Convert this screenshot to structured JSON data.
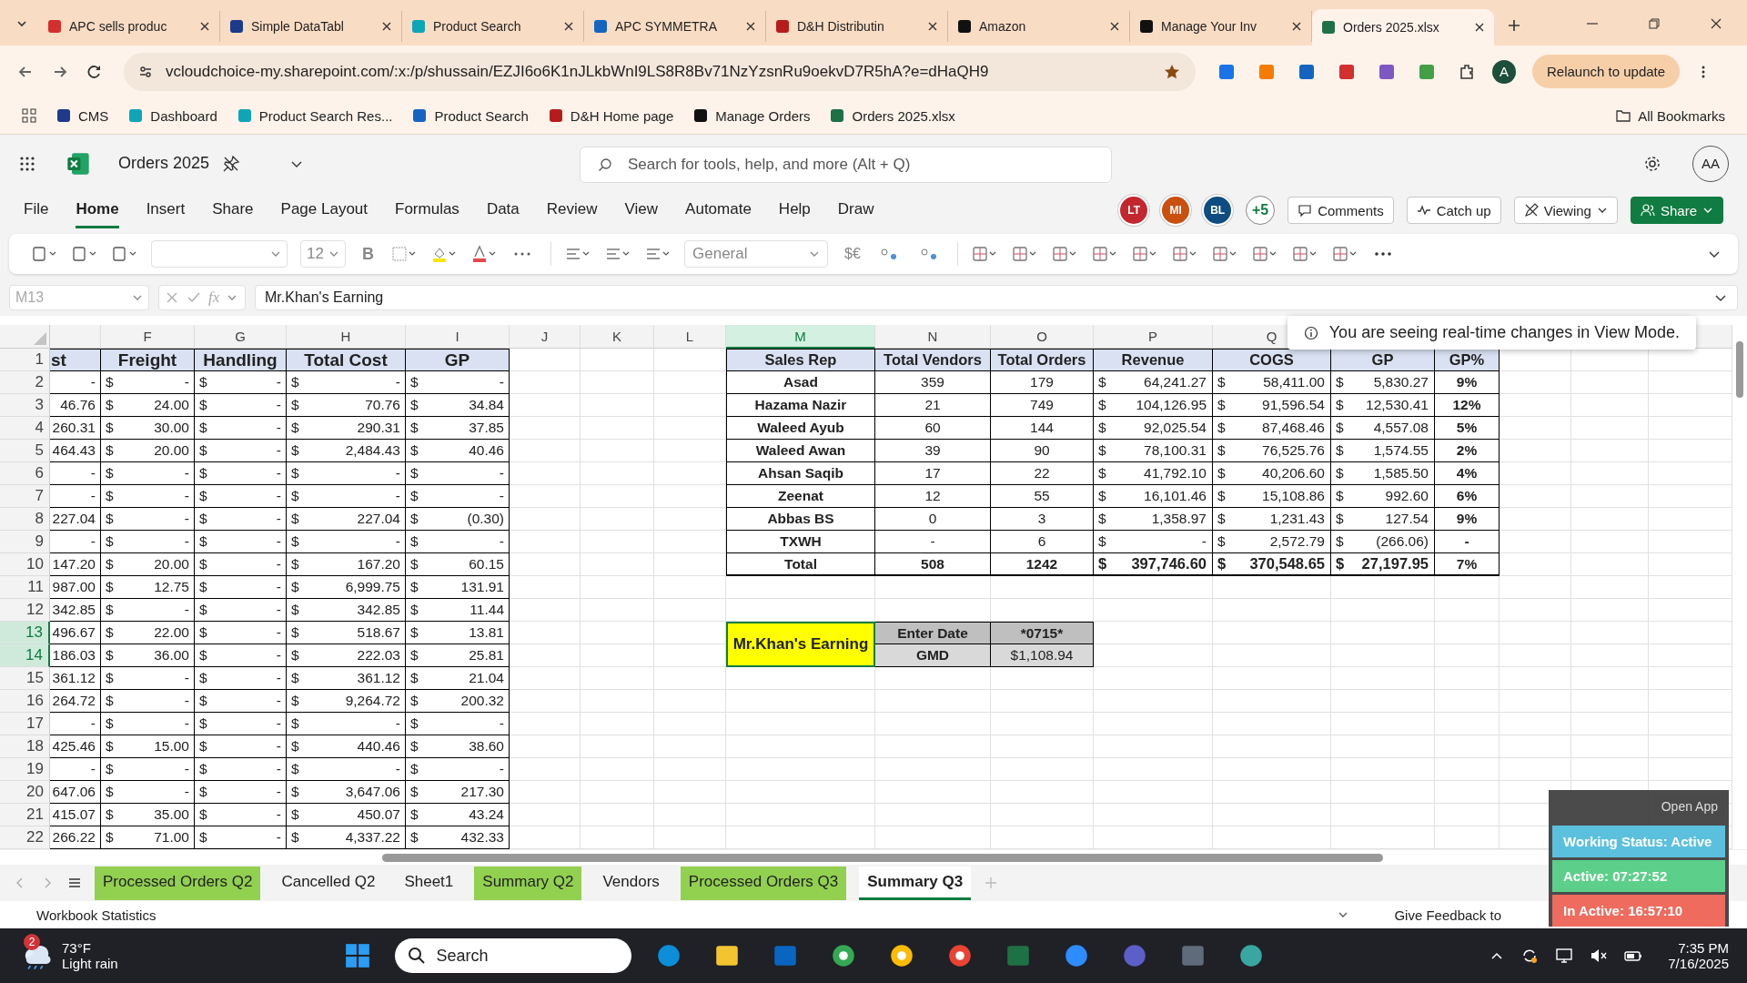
{
  "browser": {
    "tabs": [
      {
        "title": "APC sells produc",
        "selected": false
      },
      {
        "title": "Simple DataTabl",
        "selected": false
      },
      {
        "title": "Product Search",
        "selected": false
      },
      {
        "title": "APC SYMMETRA",
        "selected": false
      },
      {
        "title": "D&H Distributin",
        "selected": false
      },
      {
        "title": "Amazon",
        "selected": false
      },
      {
        "title": "Manage Your Inv",
        "selected": false
      },
      {
        "title": "Orders 2025.xlsx",
        "selected": true
      }
    ],
    "url": "vcloudchoice-my.sharepoint.com/:x:/p/shussain/EZJI6o6K1nJLkbWnI9LS8R8Bv71NzYzsnRu9oekvD7R5hA?e=dHaQH9",
    "profile": "A",
    "relaunch": "Relaunch to update",
    "bookmarks": [
      {
        "label": "CMS"
      },
      {
        "label": "Dashboard"
      },
      {
        "label": "Product Search Res..."
      },
      {
        "label": "Product Search"
      },
      {
        "label": "D&H Home page"
      },
      {
        "label": "Manage Orders"
      },
      {
        "label": "Orders 2025.xlsx"
      }
    ],
    "all_bookmarks": "All Bookmarks"
  },
  "excel": {
    "title": "Orders 2025",
    "search_placeholder": "Search for tools, help, and more (Alt + Q)",
    "account": "AA",
    "menu": [
      {
        "label": "File",
        "selected": false
      },
      {
        "label": "Home",
        "selected": true
      },
      {
        "label": "Insert",
        "selected": false
      },
      {
        "label": "Share",
        "selected": false
      },
      {
        "label": "Page Layout",
        "selected": false
      },
      {
        "label": "Formulas",
        "selected": false
      },
      {
        "label": "Data",
        "selected": false
      },
      {
        "label": "Review",
        "selected": false
      },
      {
        "label": "View",
        "selected": false
      },
      {
        "label": "Automate",
        "selected": false
      },
      {
        "label": "Help",
        "selected": false
      },
      {
        "label": "Draw",
        "selected": false
      }
    ],
    "collaborators": [
      {
        "initials": "LT",
        "color": "#c4262e"
      },
      {
        "initials": "MI",
        "color": "#ca5010"
      },
      {
        "initials": "BL",
        "color": "#0f4c81"
      }
    ],
    "more_collaborators": "+5",
    "buttons": [
      {
        "label": "Comments",
        "kind": "comments"
      },
      {
        "label": "Catch up",
        "kind": "catchup"
      },
      {
        "label": "Viewing",
        "kind": "viewing"
      },
      {
        "label": "Share",
        "kind": "share"
      }
    ],
    "ribbon": {
      "font_size": "12",
      "bold": "B",
      "number_format": "General",
      "currency": "$€"
    },
    "formula_bar": {
      "name_box": "M13",
      "function_label": "fx",
      "formula": "Mr.Khan's Earning"
    }
  },
  "sheet": {
    "notice": "You are seeing real-time changes in View Mode.",
    "columns": [
      {
        "letter": "F",
        "selected": false
      },
      {
        "letter": "G",
        "selected": false
      },
      {
        "letter": "H",
        "selected": false
      },
      {
        "letter": "I",
        "selected": false
      },
      {
        "letter": "J",
        "selected": false
      },
      {
        "letter": "K",
        "selected": false
      },
      {
        "letter": "L",
        "selected": false
      },
      {
        "letter": "M",
        "selected": true
      },
      {
        "letter": "N",
        "selected": false
      },
      {
        "letter": "O",
        "selected": false
      },
      {
        "letter": "P",
        "selected": false
      },
      {
        "letter": "Q",
        "selected": false
      }
    ],
    "row_headers": [
      {
        "label": "1",
        "selected": false
      },
      {
        "label": "2",
        "selected": false
      },
      {
        "label": "3",
        "selected": false
      },
      {
        "label": "4",
        "selected": false
      },
      {
        "label": "5",
        "selected": false
      },
      {
        "label": "6",
        "selected": false
      },
      {
        "label": "7",
        "selected": false
      },
      {
        "label": "8",
        "selected": false
      },
      {
        "label": "9",
        "selected": false
      },
      {
        "label": "10",
        "selected": false
      },
      {
        "label": "11",
        "selected": false
      },
      {
        "label": "12",
        "selected": false
      },
      {
        "label": "13",
        "selected": true
      },
      {
        "label": "14",
        "selected": true
      },
      {
        "label": "15",
        "selected": false
      },
      {
        "label": "16",
        "selected": false
      },
      {
        "label": "17",
        "selected": false
      },
      {
        "label": "18",
        "selected": false
      },
      {
        "label": "19",
        "selected": false
      },
      {
        "label": "20",
        "selected": false
      },
      {
        "label": "21",
        "selected": false
      },
      {
        "label": "22",
        "selected": false
      }
    ],
    "left_table": {
      "header": [
        "st",
        "Freight",
        "Handling",
        "Total Cost",
        "GP"
      ],
      "rows": [
        [
          "-",
          "$",
          "-",
          "$",
          "-",
          "$",
          "-",
          "$",
          "-"
        ],
        [
          "46.76",
          "$",
          "24.00",
          "$",
          "-",
          "$",
          "70.76",
          "$",
          "34.84"
        ],
        [
          "260.31",
          "$",
          "30.00",
          "$",
          "-",
          "$",
          "290.31",
          "$",
          "37.85"
        ],
        [
          "464.43",
          "$",
          "20.00",
          "$",
          "-",
          "$",
          "2,484.43",
          "$",
          "40.46"
        ],
        [
          "-",
          "$",
          "-",
          "$",
          "-",
          "$",
          "-",
          "$",
          "-"
        ],
        [
          "-",
          "$",
          "-",
          "$",
          "-",
          "$",
          "-",
          "$",
          "-"
        ],
        [
          "227.04",
          "$",
          "-",
          "$",
          "-",
          "$",
          "227.04",
          "$",
          "(0.30)"
        ],
        [
          "-",
          "$",
          "-",
          "$",
          "-",
          "$",
          "-",
          "$",
          "-"
        ],
        [
          "147.20",
          "$",
          "20.00",
          "$",
          "-",
          "$",
          "167.20",
          "$",
          "60.15"
        ],
        [
          "987.00",
          "$",
          "12.75",
          "$",
          "-",
          "$",
          "6,999.75",
          "$",
          "131.91"
        ],
        [
          "342.85",
          "$",
          "-",
          "$",
          "-",
          "$",
          "342.85",
          "$",
          "11.44"
        ],
        [
          "496.67",
          "$",
          "22.00",
          "$",
          "-",
          "$",
          "518.67",
          "$",
          "13.81"
        ],
        [
          "186.03",
          "$",
          "36.00",
          "$",
          "-",
          "$",
          "222.03",
          "$",
          "25.81"
        ],
        [
          "361.12",
          "$",
          "-",
          "$",
          "-",
          "$",
          "361.12",
          "$",
          "21.04"
        ],
        [
          "264.72",
          "$",
          "-",
          "$",
          "-",
          "$",
          "9,264.72",
          "$",
          "200.32"
        ],
        [
          "-",
          "$",
          "-",
          "$",
          "-",
          "$",
          "-",
          "$",
          "-"
        ],
        [
          "425.46",
          "$",
          "15.00",
          "$",
          "-",
          "$",
          "440.46",
          "$",
          "38.60"
        ],
        [
          "-",
          "$",
          "-",
          "$",
          "-",
          "$",
          "-",
          "$",
          "-"
        ],
        [
          "647.06",
          "$",
          "-",
          "$",
          "-",
          "$",
          "3,647.06",
          "$",
          "217.30"
        ],
        [
          "415.07",
          "$",
          "35.00",
          "$",
          "-",
          "$",
          "450.07",
          "$",
          "43.24"
        ],
        [
          "266.22",
          "$",
          "71.00",
          "$",
          "-",
          "$",
          "4,337.22",
          "$",
          "432.33"
        ]
      ]
    },
    "summary": {
      "header": [
        "Sales Rep",
        "Total Vendors",
        "Total Orders",
        "Revenue",
        "COGS",
        "GP",
        "GP%"
      ],
      "rows": [
        {
          "kind": "rep",
          "cells": [
            "Asad",
            "359",
            "179",
            "$",
            "64,241.27",
            "$",
            "58,411.00",
            "$",
            "5,830.27",
            "9%"
          ]
        },
        {
          "kind": "rep",
          "cells": [
            "Hazama Nazir",
            "21",
            "749",
            "$",
            "104,126.95",
            "$",
            "91,596.54",
            "$",
            "12,530.41",
            "12%"
          ]
        },
        {
          "kind": "rep",
          "cells": [
            "Waleed Ayub",
            "60",
            "144",
            "$",
            "92,025.54",
            "$",
            "87,468.46",
            "$",
            "4,557.08",
            "5%"
          ]
        },
        {
          "kind": "rep",
          "cells": [
            "Waleed Awan",
            "39",
            "90",
            "$",
            "78,100.31",
            "$",
            "76,525.76",
            "$",
            "1,574.55",
            "2%"
          ]
        },
        {
          "kind": "rep",
          "cells": [
            "Ahsan Saqib",
            "17",
            "22",
            "$",
            "41,792.10",
            "$",
            "40,206.60",
            "$",
            "1,585.50",
            "4%"
          ]
        },
        {
          "kind": "rep",
          "cells": [
            "Zeenat",
            "12",
            "55",
            "$",
            "16,101.46",
            "$",
            "15,108.86",
            "$",
            "992.60",
            "6%"
          ]
        },
        {
          "kind": "rep",
          "cells": [
            "Abbas BS",
            "0",
            "3",
            "$",
            "1,358.97",
            "$",
            "1,231.43",
            "$",
            "127.54",
            "9%"
          ]
        },
        {
          "kind": "rep",
          "cells": [
            "TXWH",
            "-",
            "6",
            "$",
            "-",
            "$",
            "2,572.79",
            "$",
            "(266.06)",
            "-"
          ]
        },
        {
          "kind": "total",
          "cells": [
            "Total",
            "508",
            "1242",
            "$",
            "397,746.60",
            "$",
            "370,548.65",
            "$",
            "27,197.95",
            "7%"
          ]
        }
      ]
    },
    "earning": {
      "label": "Mr.Khan's Earning",
      "selected": true,
      "fields": [
        {
          "label": "Enter Date",
          "value": "*0715*",
          "bold": true
        },
        {
          "label": "GMD",
          "value": "$1,108.94",
          "bold": false
        }
      ]
    },
    "tabs": [
      {
        "label": "Processed Orders Q2",
        "selected": false,
        "color": "#92d050"
      },
      {
        "label": "Cancelled Q2",
        "selected": false
      },
      {
        "label": "Sheet1",
        "selected": false
      },
      {
        "label": "Summary Q2",
        "selected": false,
        "color": "#92d050"
      },
      {
        "label": "Vendors",
        "selected": false
      },
      {
        "label": "Processed Orders Q3",
        "selected": false,
        "color": "#92d050"
      },
      {
        "label": "Summary Q3",
        "selected": true
      }
    ]
  },
  "status_bar": {
    "left": "Workbook Statistics",
    "feedback": "Give Feedback to"
  },
  "tracker": {
    "open_app": "Open App",
    "items": [
      {
        "text": "Working Status: Active",
        "color": "#5bc0de"
      },
      {
        "text": "Active: 07:27:52",
        "color": "#5cd08a"
      },
      {
        "text": "In Active: 16:57:10",
        "color": "#ee6b5e"
      }
    ]
  },
  "taskbar": {
    "weather_badge": "2",
    "temperature": "73°F",
    "weather": "Light rain",
    "search": "Search",
    "time": "7:35 PM",
    "date": "7/16/2025"
  }
}
